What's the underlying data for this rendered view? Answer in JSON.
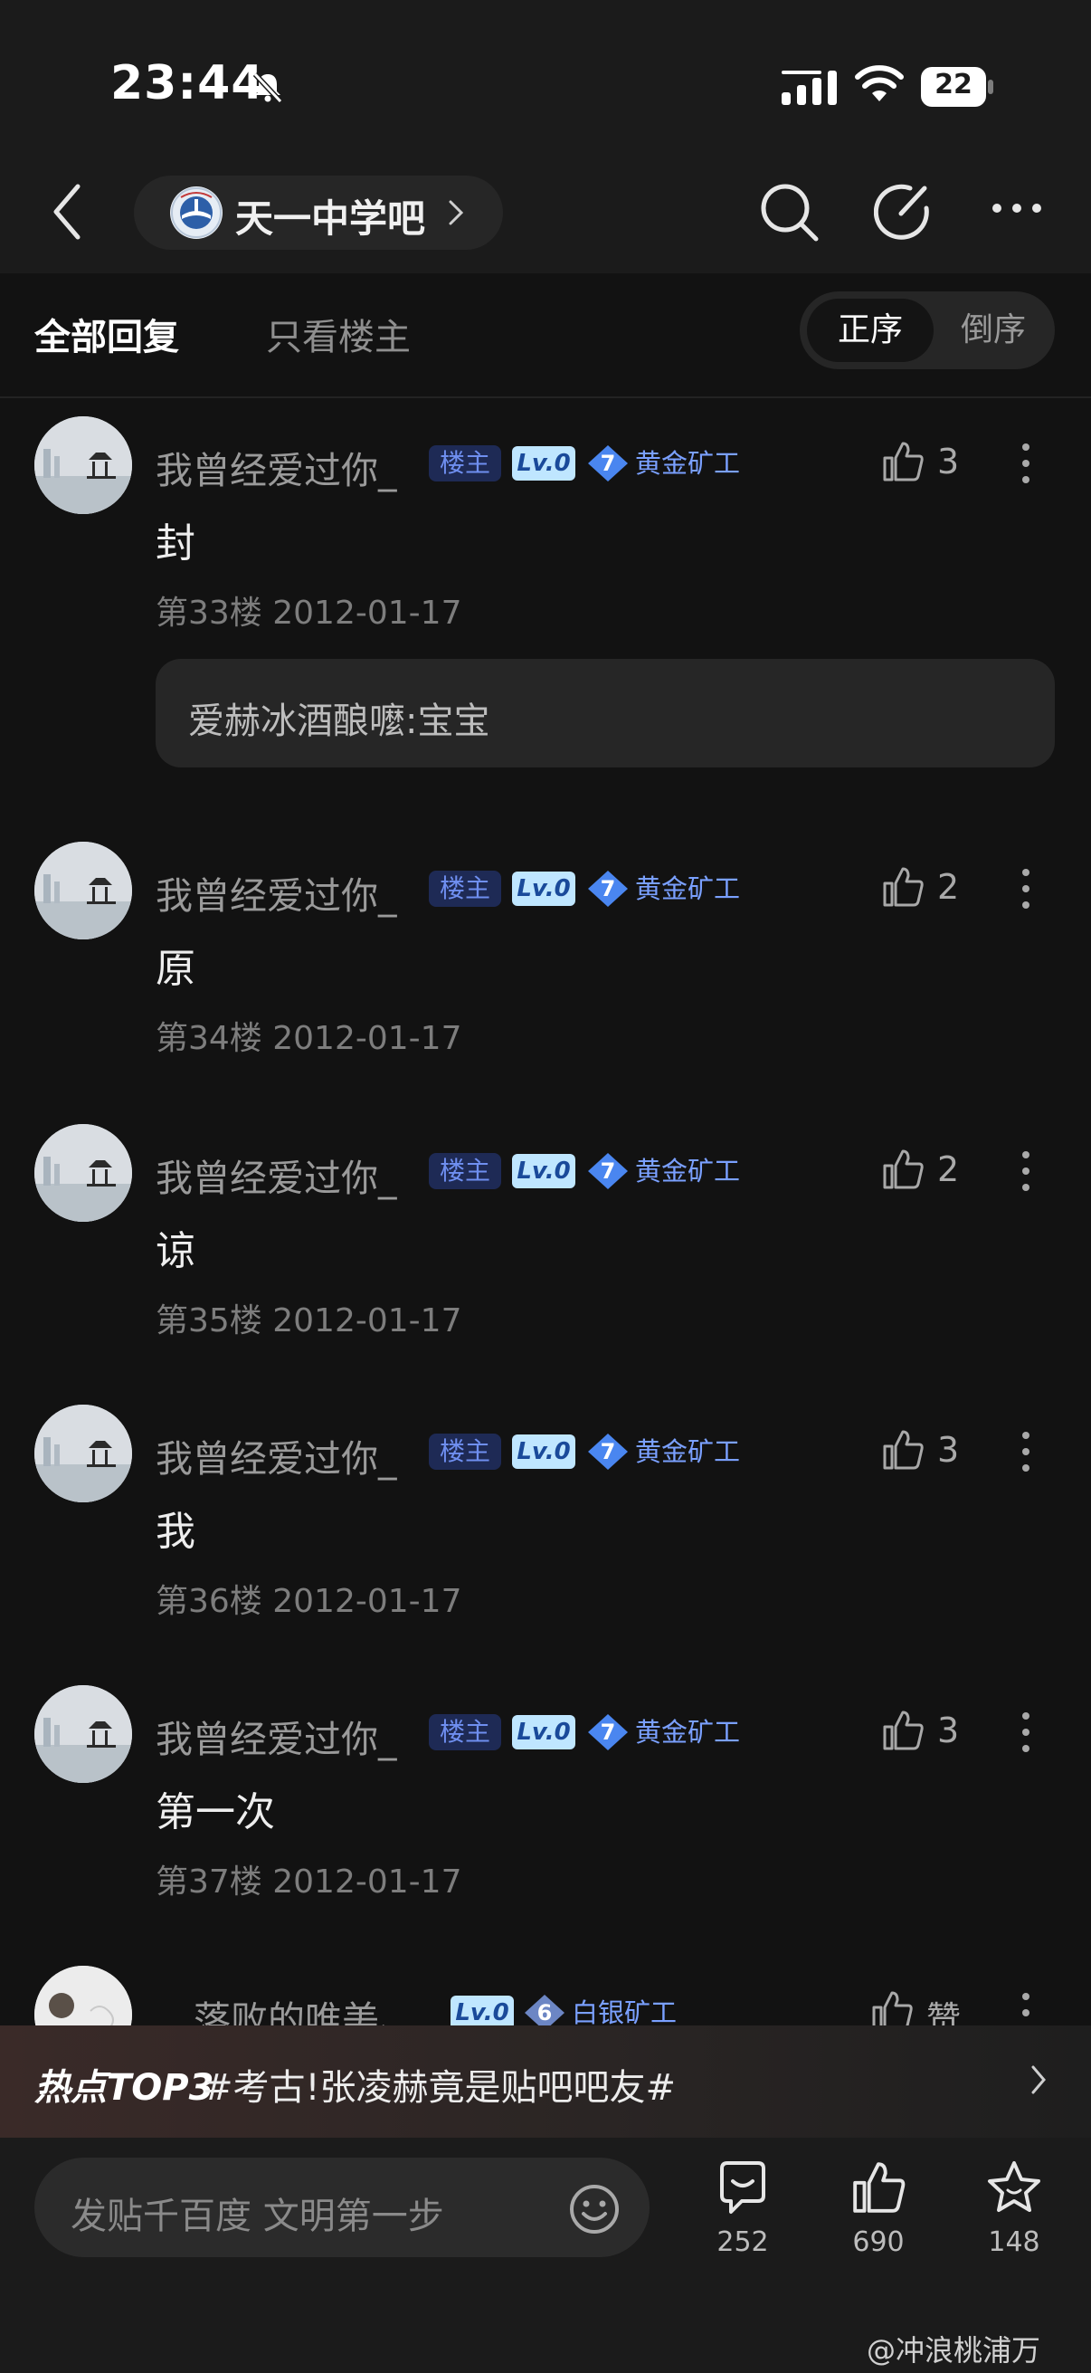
{
  "status_bar": {
    "time": "23:44",
    "battery": "22",
    "mute_icon": "bell-slash-icon",
    "signal_icon": "signal-bars-icon",
    "wifi_icon": "wifi-icon"
  },
  "nav": {
    "forum_name": "天一中学吧",
    "back_icon": "chevron-left-icon",
    "search_icon": "search-icon",
    "compose_icon": "edit-icon",
    "more_icon": "more-horizontal-icon"
  },
  "tabs": {
    "all_replies": "全部回复",
    "only_op": "只看楼主"
  },
  "sort": {
    "asc": "正序",
    "desc": "倒序"
  },
  "colors": {
    "background": "#121212",
    "accent_blue": "#7aa0ff",
    "op_badge": "#6f8ff0"
  },
  "posts": [
    {
      "user": "我曾经爱过你_",
      "op_badge": "楼主",
      "level": "Lv.0",
      "rank_level": "7",
      "rank_name": "黄金矿工",
      "likes": "3",
      "content": "封",
      "floor_date": "第33楼 2012-01-17",
      "reply": "爱赫冰酒酿嚒:宝宝"
    },
    {
      "user": "我曾经爱过你_",
      "op_badge": "楼主",
      "level": "Lv.0",
      "rank_level": "7",
      "rank_name": "黄金矿工",
      "likes": "2",
      "content": "原",
      "floor_date": "第34楼 2012-01-17"
    },
    {
      "user": "我曾经爱过你_",
      "op_badge": "楼主",
      "level": "Lv.0",
      "rank_level": "7",
      "rank_name": "黄金矿工",
      "likes": "2",
      "content": "谅",
      "floor_date": "第35楼 2012-01-17"
    },
    {
      "user": "我曾经爱过你_",
      "op_badge": "楼主",
      "level": "Lv.0",
      "rank_level": "7",
      "rank_name": "黄金矿工",
      "likes": "3",
      "content": "我",
      "floor_date": "第36楼 2012-01-17"
    },
    {
      "user": "我曾经爱过你_",
      "op_badge": "楼主",
      "level": "Lv.0",
      "rank_level": "7",
      "rank_name": "黄金矿工",
      "likes": "3",
      "content": "第一次",
      "floor_date": "第37楼 2012-01-17"
    },
    {
      "user": "落败的唯美、",
      "level": "Lv.0",
      "rank_level": "6",
      "rank_name": "白银矿工",
      "likes": "赞"
    }
  ],
  "hot": {
    "tag": "热点TOP3",
    "topic": "#考古!张凌赫竟是贴吧吧友#"
  },
  "bottom_bar": {
    "placeholder": "发贴千百度 文明第一步",
    "comments": "252",
    "likes": "690",
    "favorites": "148"
  },
  "watermark": "@冲浪桃浦万"
}
